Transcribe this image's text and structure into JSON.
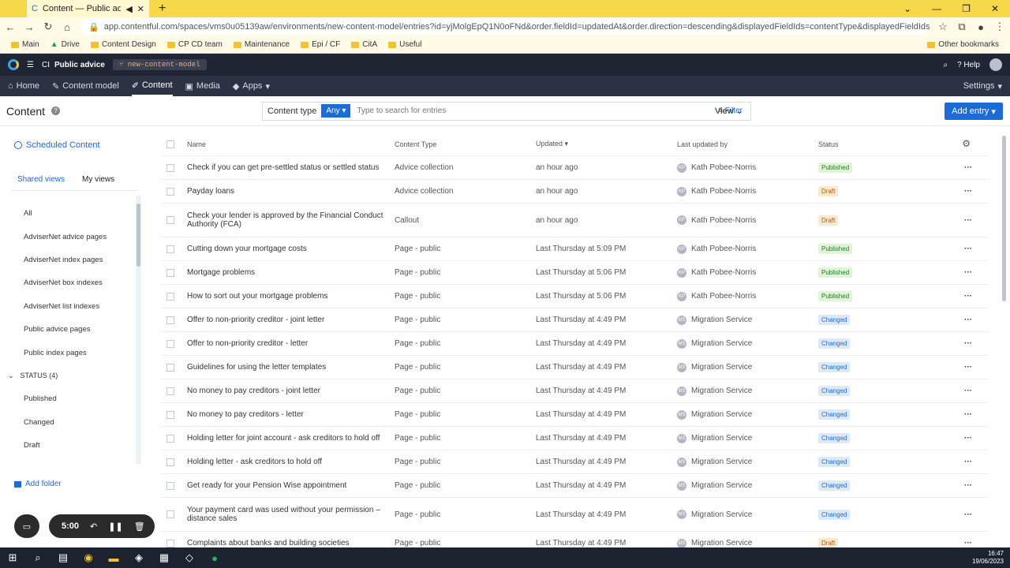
{
  "browser": {
    "tab_title": "Content — Public advice —",
    "url": "app.contentful.com/spaces/vms0u05139aw/environments/new-content-model/entries?id=yjMolgEpQ1N0oFNd&order.fieldId=updatedAt&order.direction=descending&displayedFieldIds=contentType&displayedFieldIds=updat...",
    "bookmarks": [
      "Main",
      "Drive",
      "Content Design",
      "CP CD team",
      "Maintenance",
      "Epi / CF",
      "CitA",
      "Useful"
    ],
    "other_bookmarks": "Other bookmarks"
  },
  "app": {
    "space_initials": "CI",
    "space_name": "Public advice",
    "environment": "new-content-model",
    "help": "Help",
    "nav": [
      "Home",
      "Content model",
      "Content",
      "Media",
      "Apps"
    ],
    "settings": "Settings"
  },
  "toolbar": {
    "title": "Content",
    "content_type_label": "Content type",
    "content_type_value": "Any",
    "search_placeholder": "Type to search for entries",
    "filter": "Filter",
    "view": "View",
    "add_entry": "Add entry"
  },
  "sidebar": {
    "scheduled": "Scheduled Content",
    "tabs": [
      "Shared views",
      "My views"
    ],
    "views": [
      "All",
      "AdviserNet advice pages",
      "AdviserNet index pages",
      "AdviserNet box indexes",
      "AdviserNet list indexes",
      "Public advice pages",
      "Public index pages"
    ],
    "status_header": "STATUS (4)",
    "status_items": [
      "Published",
      "Changed",
      "Draft"
    ],
    "add_folder": "Add folder"
  },
  "table": {
    "headers": [
      "Name",
      "Content Type",
      "Updated",
      "Last updated by",
      "Status"
    ],
    "rows": [
      {
        "name": "Check if you can get pre-settled status or settled status",
        "type": "Advice collection",
        "updated": "an hour ago",
        "by_initials": "KP",
        "by": "Kath Pobee-Norris",
        "status": "Published",
        "tall": false
      },
      {
        "name": "Payday loans",
        "type": "Advice collection",
        "updated": "an hour ago",
        "by_initials": "KP",
        "by": "Kath Pobee-Norris",
        "status": "Draft",
        "tall": false
      },
      {
        "name": "Check your lender is approved by the Financial Conduct Authority (FCA)",
        "type": "Callout",
        "updated": "an hour ago",
        "by_initials": "KP",
        "by": "Kath Pobee-Norris",
        "status": "Draft",
        "tall": true
      },
      {
        "name": "Cutting down your mortgage costs",
        "type": "Page - public",
        "updated": "Last Thursday at 5:09 PM",
        "by_initials": "KP",
        "by": "Kath Pobee-Norris",
        "status": "Published",
        "tall": false
      },
      {
        "name": "Mortgage problems",
        "type": "Page - public",
        "updated": "Last Thursday at 5:06 PM",
        "by_initials": "KP",
        "by": "Kath Pobee-Norris",
        "status": "Published",
        "tall": false
      },
      {
        "name": "How to sort out your mortgage problems",
        "type": "Page - public",
        "updated": "Last Thursday at 5:06 PM",
        "by_initials": "KP",
        "by": "Kath Pobee-Norris",
        "status": "Published",
        "tall": false
      },
      {
        "name": "Offer to non-priority creditor - joint letter",
        "type": "Page - public",
        "updated": "Last Thursday at 4:49 PM",
        "by_initials": "MS",
        "by": "Migration Service",
        "status": "Changed",
        "tall": false
      },
      {
        "name": "Offer to non-priority creditor - letter",
        "type": "Page - public",
        "updated": "Last Thursday at 4:49 PM",
        "by_initials": "MS",
        "by": "Migration Service",
        "status": "Changed",
        "tall": false
      },
      {
        "name": "Guidelines for using the letter templates",
        "type": "Page - public",
        "updated": "Last Thursday at 4:49 PM",
        "by_initials": "MS",
        "by": "Migration Service",
        "status": "Changed",
        "tall": false
      },
      {
        "name": "No money to pay creditors - joint letter",
        "type": "Page - public",
        "updated": "Last Thursday at 4:49 PM",
        "by_initials": "MS",
        "by": "Migration Service",
        "status": "Changed",
        "tall": false
      },
      {
        "name": "No money to pay creditors - letter",
        "type": "Page - public",
        "updated": "Last Thursday at 4:49 PM",
        "by_initials": "MS",
        "by": "Migration Service",
        "status": "Changed",
        "tall": false
      },
      {
        "name": "Holding letter for joint account - ask creditors to hold off",
        "type": "Page - public",
        "updated": "Last Thursday at 4:49 PM",
        "by_initials": "MS",
        "by": "Migration Service",
        "status": "Changed",
        "tall": false
      },
      {
        "name": "Holding letter - ask creditors to hold off",
        "type": "Page - public",
        "updated": "Last Thursday at 4:49 PM",
        "by_initials": "MS",
        "by": "Migration Service",
        "status": "Changed",
        "tall": false
      },
      {
        "name": "Get ready for your Pension Wise appointment",
        "type": "Page - public",
        "updated": "Last Thursday at 4:49 PM",
        "by_initials": "MS",
        "by": "Migration Service",
        "status": "Changed",
        "tall": false
      },
      {
        "name": "Your payment card was used without your permission – distance sales",
        "type": "Page - public",
        "updated": "Last Thursday at 4:49 PM",
        "by_initials": "MS",
        "by": "Migration Service",
        "status": "Changed",
        "tall": true
      },
      {
        "name": "Complaints about banks and building societies",
        "type": "Page - public",
        "updated": "Last Thursday at 4:49 PM",
        "by_initials": "MS",
        "by": "Migration Service",
        "status": "Draft",
        "tall": false
      }
    ]
  },
  "recorder": {
    "time": "5:00"
  },
  "taskbar": {
    "time": "16:47",
    "date": "19/06/2023"
  }
}
